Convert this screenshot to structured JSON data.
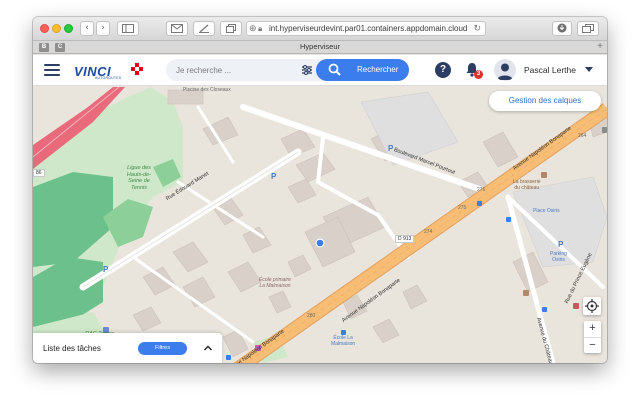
{
  "browser": {
    "url": "int.hyperviseurdevint.par01.containers.appdomain.cloud",
    "tab_title": "Hyperviseur",
    "favorites": [
      "B",
      "C"
    ]
  },
  "header": {
    "logo": "VINCI",
    "logo_sub": "AUTOROUTES",
    "search_placeholder": "Je recherche ...",
    "search_button": "Rechercher",
    "help": "?",
    "notifications_count": "3",
    "user_name": "Pascal Lerthe"
  },
  "map": {
    "layers_button": "Gestion des calques",
    "zoom_in": "+",
    "zoom_out": "−",
    "labels": {
      "piscine": "Piscine\ndes Closeaux",
      "ligue": "Ligue des\nHauts-de-\nSeine de\nTennis",
      "rac_tennis": "RAC Tennis",
      "rue_edouard": "Rue Édouard Manet",
      "bd_marcel": "Boulevard Marcel Pourtout",
      "av_napoleon_top": "Avenue Napoléon Bonaparte",
      "av_napoleon_mid": "Avenue Napoléon Bonaparte",
      "av_napoleon_bot": "Avenue Napoléon Bonaparte",
      "ecole_primaire": "École primaire\nLa Malmaison",
      "ecole_malmaison": "École La\nMalmaison",
      "brasserie": "La brasserie\ndu château",
      "place_osiris": "Place Osiris",
      "parking_osiris": "Parking\nOsiris",
      "rue_prince": "Rue du Prince Eugène",
      "av_chateau": "Avenue du Château",
      "d913": "D 913",
      "n86": "86",
      "num_276": "276",
      "num_274": "274",
      "num_275": "275",
      "num_280": "280",
      "num_264": "264"
    }
  },
  "tasks": {
    "title": "Liste des tâches",
    "filter_button": "Filtres"
  },
  "colors": {
    "accent": "#3b7ded",
    "brand": "#1b4aa0",
    "brand_red": "#e2001a",
    "map_bg": "#e9e5dd",
    "park": "#c8e9c6",
    "road_major": "#f2a65a",
    "badge": "#e0302b"
  }
}
